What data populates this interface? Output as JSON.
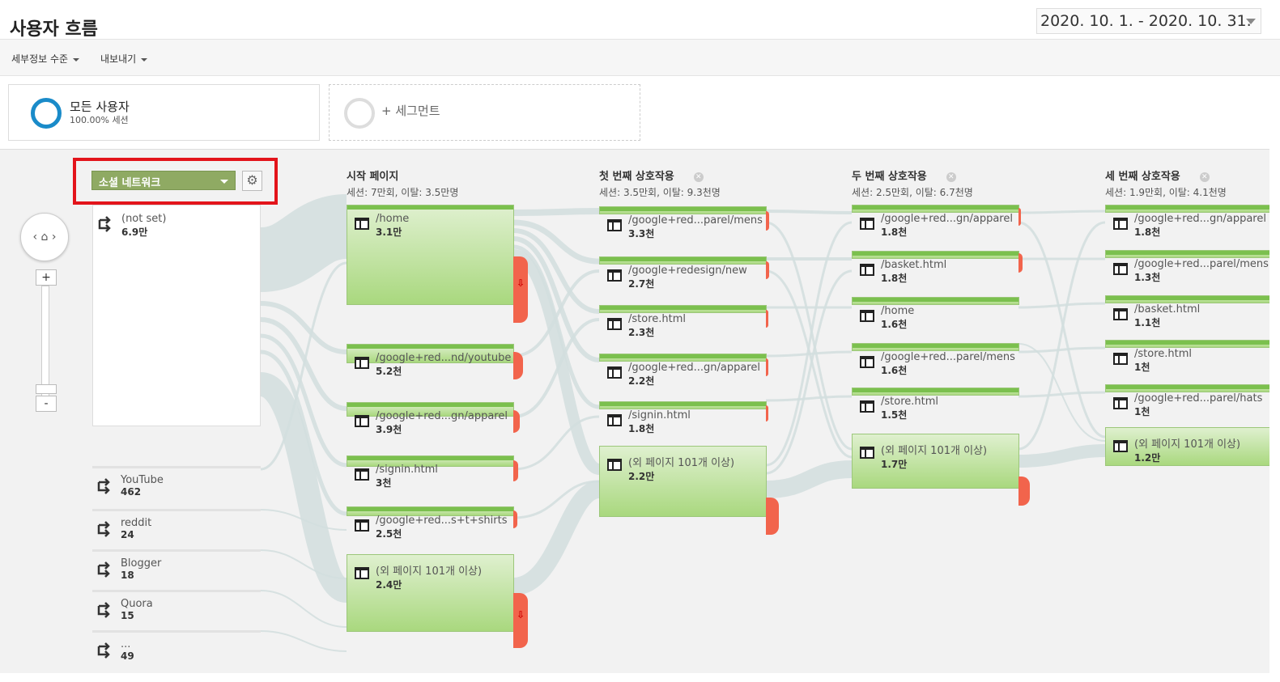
{
  "page": {
    "title": "사용자 흐름",
    "date_range": "2020. 10. 1. - 2020. 10. 31."
  },
  "toolbar": {
    "detail_level": "세부정보 수준",
    "export": "내보내기"
  },
  "segments": {
    "active": {
      "name": "모든 사용자",
      "pct": "100.00% 세션",
      "color": "#1a8bc9"
    },
    "add": "+ 세그먼트"
  },
  "dimension": {
    "selected": "소셜 네트워크",
    "highlight_color": "#e3141b"
  },
  "columns": [
    {
      "header": "시작 페이지",
      "stats": "세션: 7만회, 이탈: 3.5만명"
    },
    {
      "header": "첫 번째 상호작용",
      "stats": "세션: 3.5만회, 이탈: 9.3천명"
    },
    {
      "header": "두 번째 상호작용",
      "stats": "세션: 2.5만회, 이탈: 6.7천명"
    },
    {
      "header": "세 번째 상호작용",
      "stats": "세션: 1.9만회, 이탈: 4.1천명"
    }
  ],
  "sources": [
    {
      "label": "(not set)",
      "value": "6.9만"
    },
    {
      "label": "YouTube",
      "value": "462"
    },
    {
      "label": "reddit",
      "value": "24"
    },
    {
      "label": "Blogger",
      "value": "18"
    },
    {
      "label": "Quora",
      "value": "15"
    },
    {
      "label": "...",
      "value": "49"
    }
  ],
  "starting_pages": [
    {
      "label": "/home",
      "value": "3.1만"
    },
    {
      "label": "/google+red...nd/youtube",
      "value": "5.2천"
    },
    {
      "label": "/google+red...gn/apparel",
      "value": "3.9천"
    },
    {
      "label": "/signin.html",
      "value": "3천"
    },
    {
      "label": "/google+red...s+t+shirts",
      "value": "2.5천"
    },
    {
      "label": "(외 페이지 101개 이상)",
      "value": "2.4만"
    }
  ],
  "first_interaction": [
    {
      "label": "/google+red...parel/mens",
      "value": "3.3천"
    },
    {
      "label": "/google+redesign/new",
      "value": "2.7천"
    },
    {
      "label": "/store.html",
      "value": "2.3천"
    },
    {
      "label": "/google+red...gn/apparel",
      "value": "2.2천"
    },
    {
      "label": "/signin.html",
      "value": "1.8천"
    },
    {
      "label": "(외 페이지 101개 이상)",
      "value": "2.2만"
    }
  ],
  "second_interaction": [
    {
      "label": "/google+red...gn/apparel",
      "value": "1.8천"
    },
    {
      "label": "/basket.html",
      "value": "1.8천"
    },
    {
      "label": "/home",
      "value": "1.6천"
    },
    {
      "label": "/google+red...parel/mens",
      "value": "1.6천"
    },
    {
      "label": "/store.html",
      "value": "1.5천"
    },
    {
      "label": "(외 페이지 101개 이상)",
      "value": "1.7만"
    }
  ],
  "third_interaction": [
    {
      "label": "/google+red...gn/apparel",
      "value": "1.8천"
    },
    {
      "label": "/google+red...parel/mens",
      "value": "1.3천"
    },
    {
      "label": "/basket.html",
      "value": "1.1천"
    },
    {
      "label": "/store.html",
      "value": "1천"
    },
    {
      "label": "/google+red...parel/hats",
      "value": "1천"
    },
    {
      "label": "(외 페이지 101개 이상)",
      "value": "1.2만"
    }
  ],
  "icons": {
    "source": "arrow-split-icon",
    "page": "page-layout-icon",
    "home": "home-icon",
    "settings": "gear-icon",
    "remove": "close-icon",
    "drop_off": "down-arrow-icon"
  },
  "colors": {
    "node_green": "#a9d87e",
    "dropoff_red": "#f2644c",
    "flow_gray": "#d5e0e0"
  }
}
